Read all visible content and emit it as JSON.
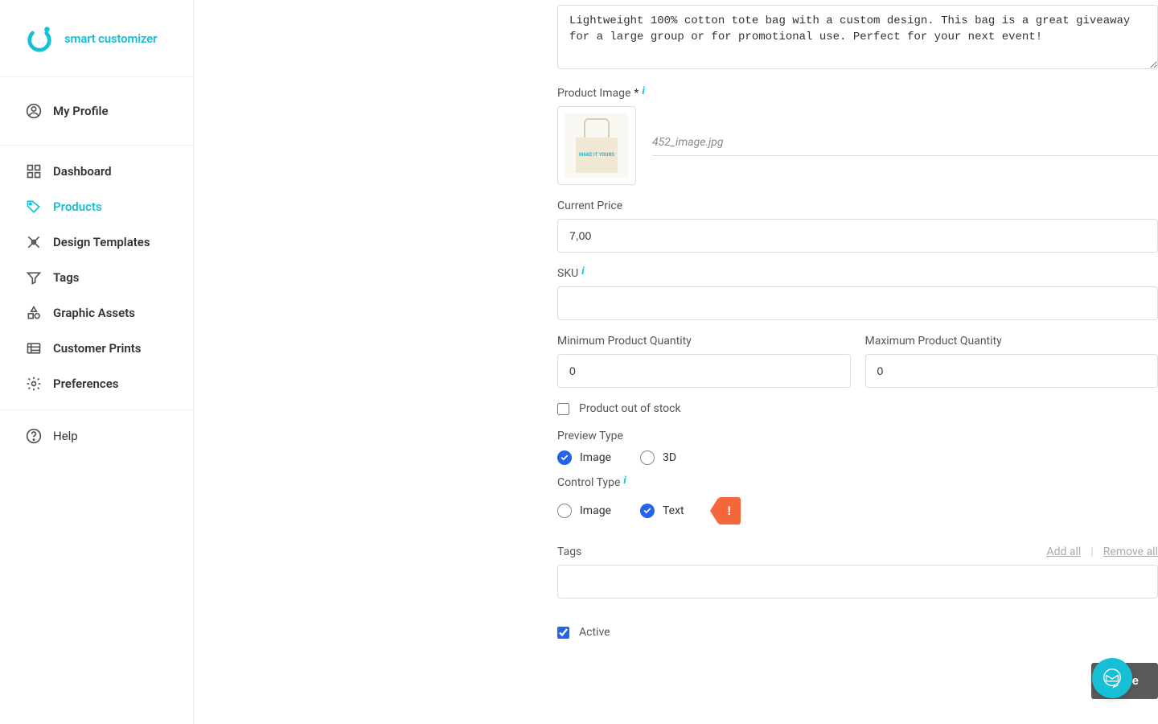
{
  "brand": {
    "name": "smart customizer"
  },
  "sidebar": {
    "profile": "My Profile",
    "items": [
      {
        "label": "Dashboard"
      },
      {
        "label": "Products"
      },
      {
        "label": "Design Templates"
      },
      {
        "label": "Tags"
      },
      {
        "label": "Graphic Assets"
      },
      {
        "label": "Customer Prints"
      },
      {
        "label": "Preferences"
      }
    ],
    "help": "Help"
  },
  "form": {
    "description_value": "Lightweight 100% cotton tote bag with a custom design. This bag is a great giveaway for a large group or for promotional use. Perfect for your next event!",
    "product_image_label": "Product Image",
    "product_image_filename": "452_image.jpg",
    "bag_print": "MAKE IT\nYOURS",
    "current_price_label": "Current Price",
    "current_price_value": "7,00",
    "sku_label": "SKU",
    "sku_value": "",
    "min_qty_label": "Minimum Product Quantity",
    "min_qty_value": "0",
    "max_qty_label": "Maximum Product Quantity",
    "max_qty_value": "0",
    "out_of_stock_label": "Product out of stock",
    "preview_type_label": "Preview Type",
    "preview_type_image": "Image",
    "preview_type_3d": "3D",
    "control_type_label": "Control Type",
    "control_type_image": "Image",
    "control_type_text": "Text",
    "warn": "!",
    "tags_label": "Tags",
    "tags_add_all": "Add all",
    "tags_remove_all": "Remove all",
    "active_label": "Active",
    "save": "Save"
  }
}
